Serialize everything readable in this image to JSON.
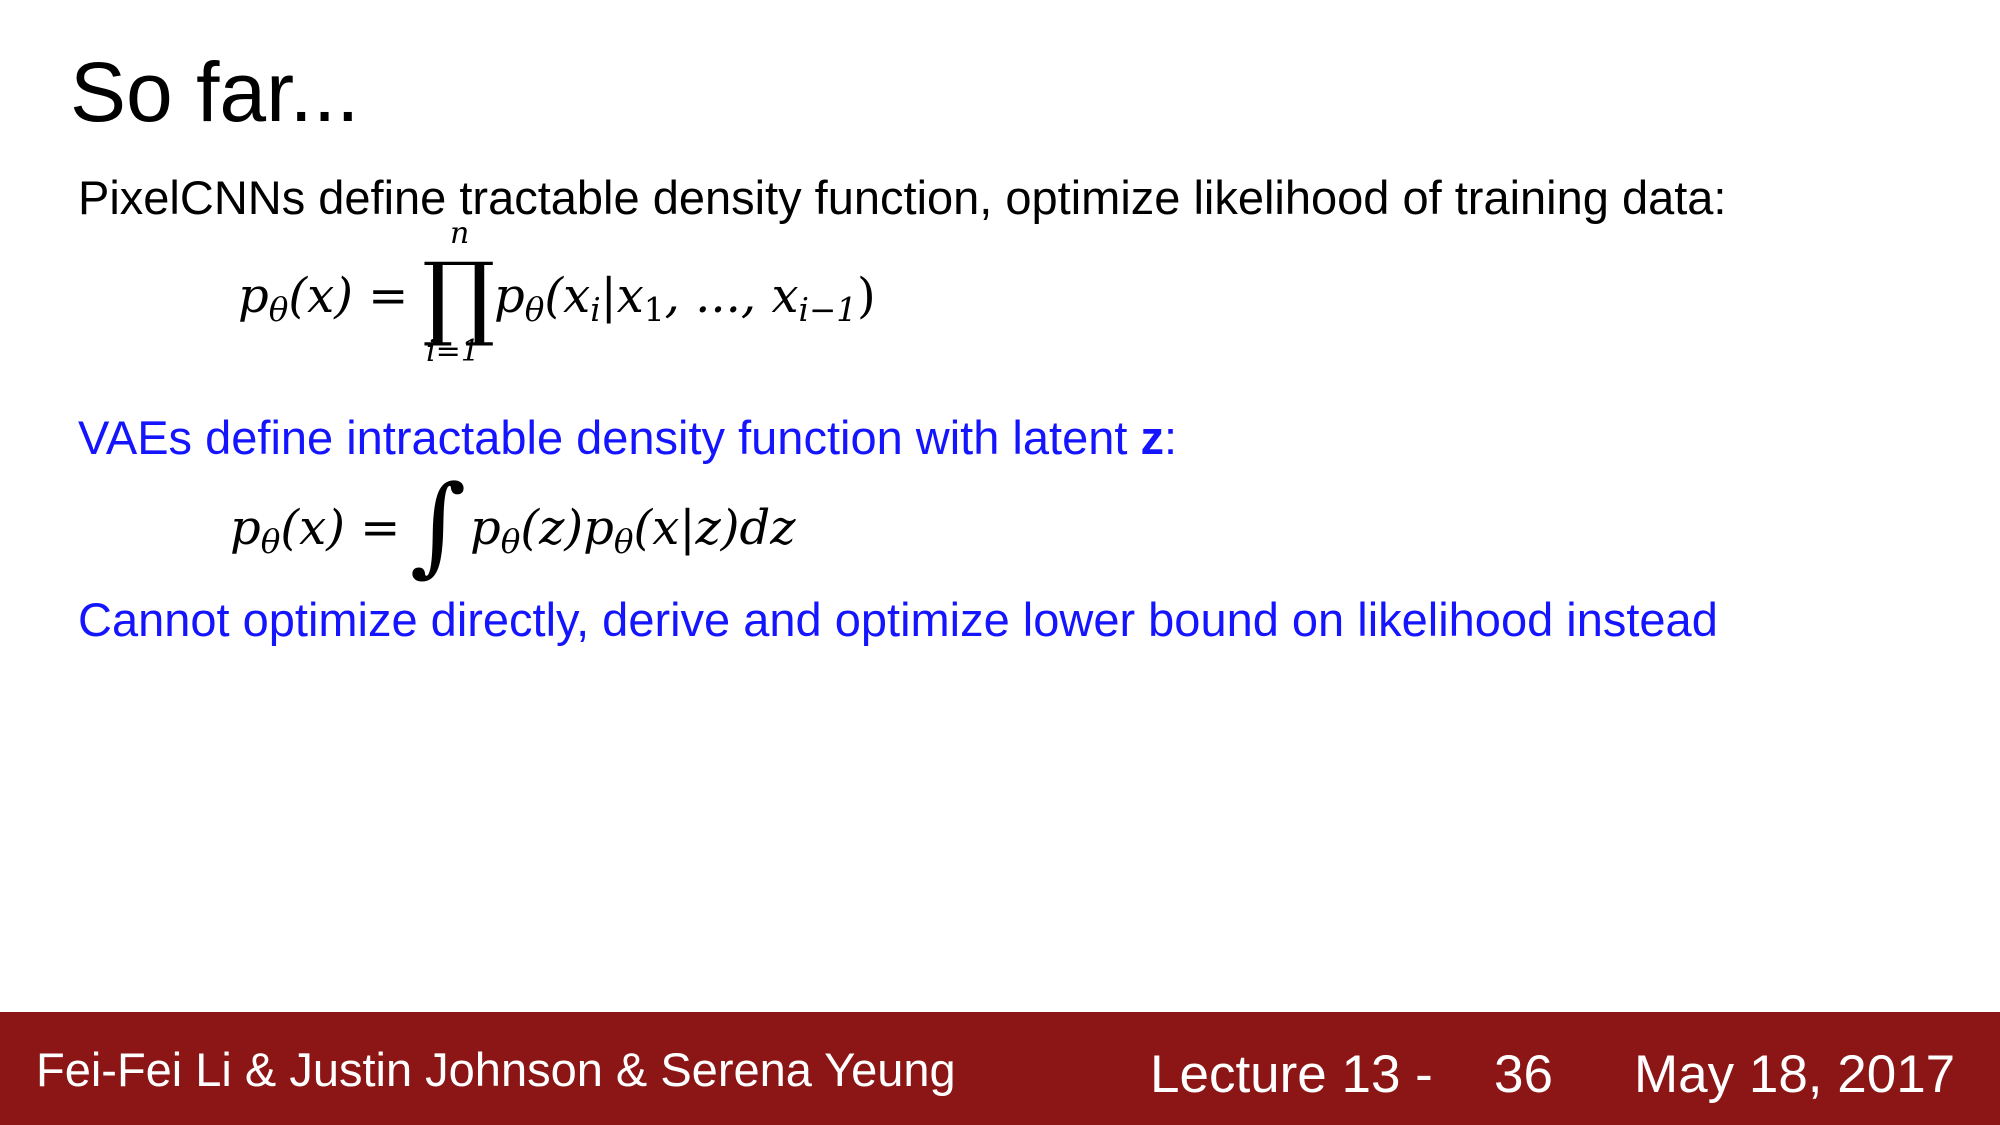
{
  "slide": {
    "title": "So far...",
    "pixelcnn_text": "PixelCNNs define tractable density function, optimize likelihood of training data:",
    "vae_text_before": "VAEs define intractable density function with latent ",
    "vae_text_bold": "z",
    "vae_text_after": ":",
    "cannot_text": "Cannot optimize directly, derive and optimize lower bound on likelihood instead"
  },
  "equation1": {
    "lhs_p": "p",
    "lhs_sub": "θ",
    "lhs_arg": "(x) =",
    "prod_symbol": "∏",
    "prod_upper": "n",
    "prod_lower": "i=1",
    "rhs_p": "p",
    "rhs_sub": "θ",
    "rhs_open": "(x",
    "rhs_sub_i": "i",
    "rhs_mid": "|x",
    "rhs_sub_1": "1",
    "rhs_dots": ", ..., x",
    "rhs_sub_im1": "i−1",
    "rhs_close": ")"
  },
  "equation2": {
    "lhs_p": "p",
    "lhs_sub": "θ",
    "lhs_arg": "(x) =",
    "int_symbol": "∫",
    "rhs_p1": "p",
    "rhs_sub1": "θ",
    "rhs_arg1": "(z)p",
    "rhs_sub2": "θ",
    "rhs_arg2": "(x|z)dz"
  },
  "footer": {
    "authors": "Fei-Fei Li & Justin Johnson & Serena Yeung",
    "lecture": "Lecture 13 -",
    "page": "36",
    "date": "May 18, 2017",
    "background_color": "#8c1515"
  },
  "colors": {
    "text_black": "#000000",
    "text_blue": "#1414ff"
  }
}
